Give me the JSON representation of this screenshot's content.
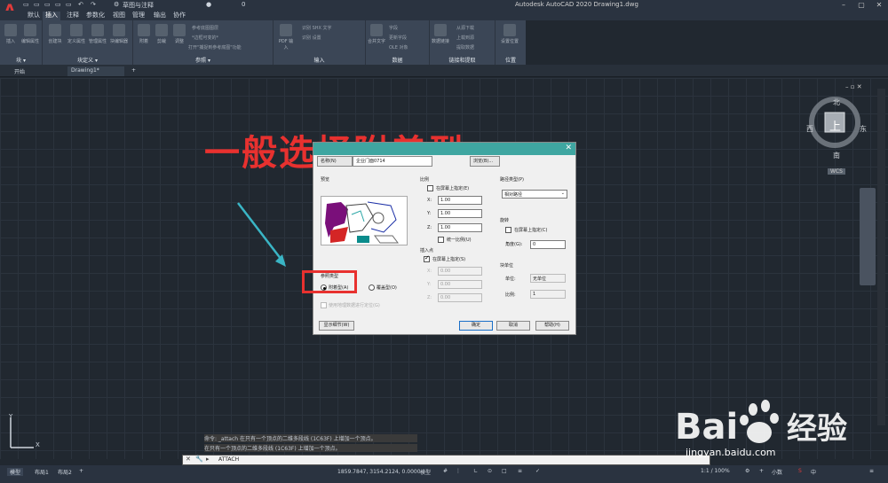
{
  "window": {
    "title": "Autodesk AutoCAD 2020    Drawing1.dwg"
  },
  "quick_access": {
    "workspace": "草图与注释",
    "layer": "0"
  },
  "menu_tabs": [
    "默认",
    "插入",
    "注释",
    "参数化",
    "视图",
    "管理",
    "输出",
    "协作"
  ],
  "ribbon": {
    "groups": [
      {
        "label": "块 ▾",
        "buttons": [
          "插入",
          "编辑属性"
        ]
      },
      {
        "label": "块定义 ▾",
        "buttons": [
          "创建块",
          "定义属性",
          "管理属性",
          "块编辑器"
        ]
      },
      {
        "label": "参照 ▾",
        "buttons": [
          "附着",
          "剪裁",
          "调整"
        ],
        "rows": [
          "参考底图图层",
          "*边框可变的*",
          "打开\"捕捉到参考底图\"功能"
        ]
      },
      {
        "label": "输入",
        "buttons": [
          "PDF 输入"
        ],
        "rows": [
          "识别 SHX 文字",
          "识别 设置"
        ]
      },
      {
        "label": "数据",
        "buttons": [
          "合并文字",
          "字段"
        ],
        "rows": [
          "更新字段",
          "OLE 对象"
        ]
      },
      {
        "label": "链接和提取",
        "buttons": [
          "数据链接"
        ],
        "rows": [
          "从源下载",
          "上载到源",
          "提取数据"
        ]
      },
      {
        "label": "位置",
        "buttons": [
          "设置位置"
        ]
      }
    ]
  },
  "doc_tabs": [
    "开始",
    "Drawing1*"
  ],
  "overlay_caption": "一般选择附着型",
  "viewcube": {
    "north": "北",
    "south": "南",
    "east": "东",
    "west": "西",
    "top": "上",
    "wcs": "WCS"
  },
  "dialog": {
    "tabs": [
      "名称(N)",
      "企业门面0714",
      "浏览(B)..."
    ],
    "preview_label": "预览",
    "scale": {
      "label": "比例",
      "specify_on_screen": "在屏幕上指定(E)",
      "x_label": "X:",
      "x": "1.00",
      "y_label": "Y:",
      "y": "1.00",
      "z_label": "Z:",
      "z": "1.00",
      "uniform": "统一比例(U)"
    },
    "insertion": {
      "label": "插入点",
      "specify_on_screen": "在屏幕上指定(S)",
      "x_label": "X:",
      "x": "0.00",
      "y_label": "Y:",
      "y": "0.00",
      "z_label": "Z:",
      "z": "0.00"
    },
    "path": {
      "label": "路径类型(P)",
      "value": "相对路径"
    },
    "rotation": {
      "label": "旋转",
      "specify_on_screen": "在屏幕上指定(C)",
      "angle_label": "角度(G):",
      "angle": "0"
    },
    "block_unit": {
      "label": "块单位",
      "unit_label": "单位:",
      "unit": "无单位",
      "factor_label": "比例:",
      "factor": "1"
    },
    "reference_type": {
      "label": "参照类型",
      "attach": "附着型(A)",
      "overlay": "覆盖型(O)",
      "selected": "attach"
    },
    "geo": "使用地理数据进行定位(G)",
    "show_details": "显示细节(W)",
    "ok": "确定",
    "cancel": "取消",
    "help": "帮助(H)"
  },
  "command": {
    "history": [
      "命令: _attach 在只有一个顶点的二维多段线 (1C63F) 上增加一个顶点。",
      "在只有一个顶点的二维多段线 (1C63F) 上增加一个顶点。"
    ],
    "prompt": "ATTACH"
  },
  "status": {
    "layout_tabs": [
      "模型",
      "布局1",
      "布局2"
    ],
    "coords": "1859.7847, 3154.2124, 0.0000",
    "model": "模型",
    "scale": "1:1 / 100%",
    "decimal": "小数"
  },
  "ucs": {
    "x": "X",
    "y": "Y"
  },
  "watermark": {
    "brand": "Bai 经验",
    "url": "jingyan.baidu.com"
  }
}
